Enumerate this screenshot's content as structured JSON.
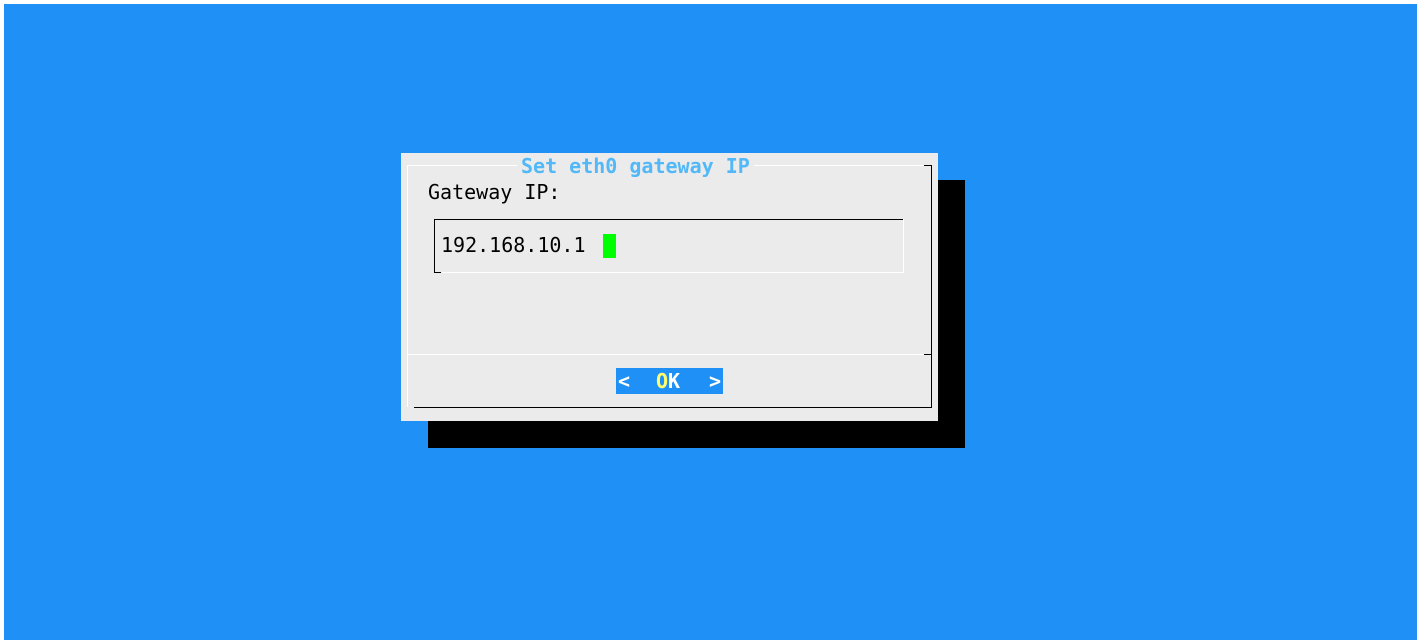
{
  "dialog": {
    "title": "Set eth0 gateway IP",
    "prompt": "Gateway IP:",
    "input_value": "192.168.10.1"
  },
  "button": {
    "left_bracket": "<",
    "hotkey": "O",
    "label_rest": "K",
    "right_bracket": ">"
  },
  "colors": {
    "background": "#1f90f5",
    "dialog": "#ebebeb",
    "title": "#52b8f7",
    "cursor": "#00ff00",
    "hotkey": "#ffff6e"
  }
}
